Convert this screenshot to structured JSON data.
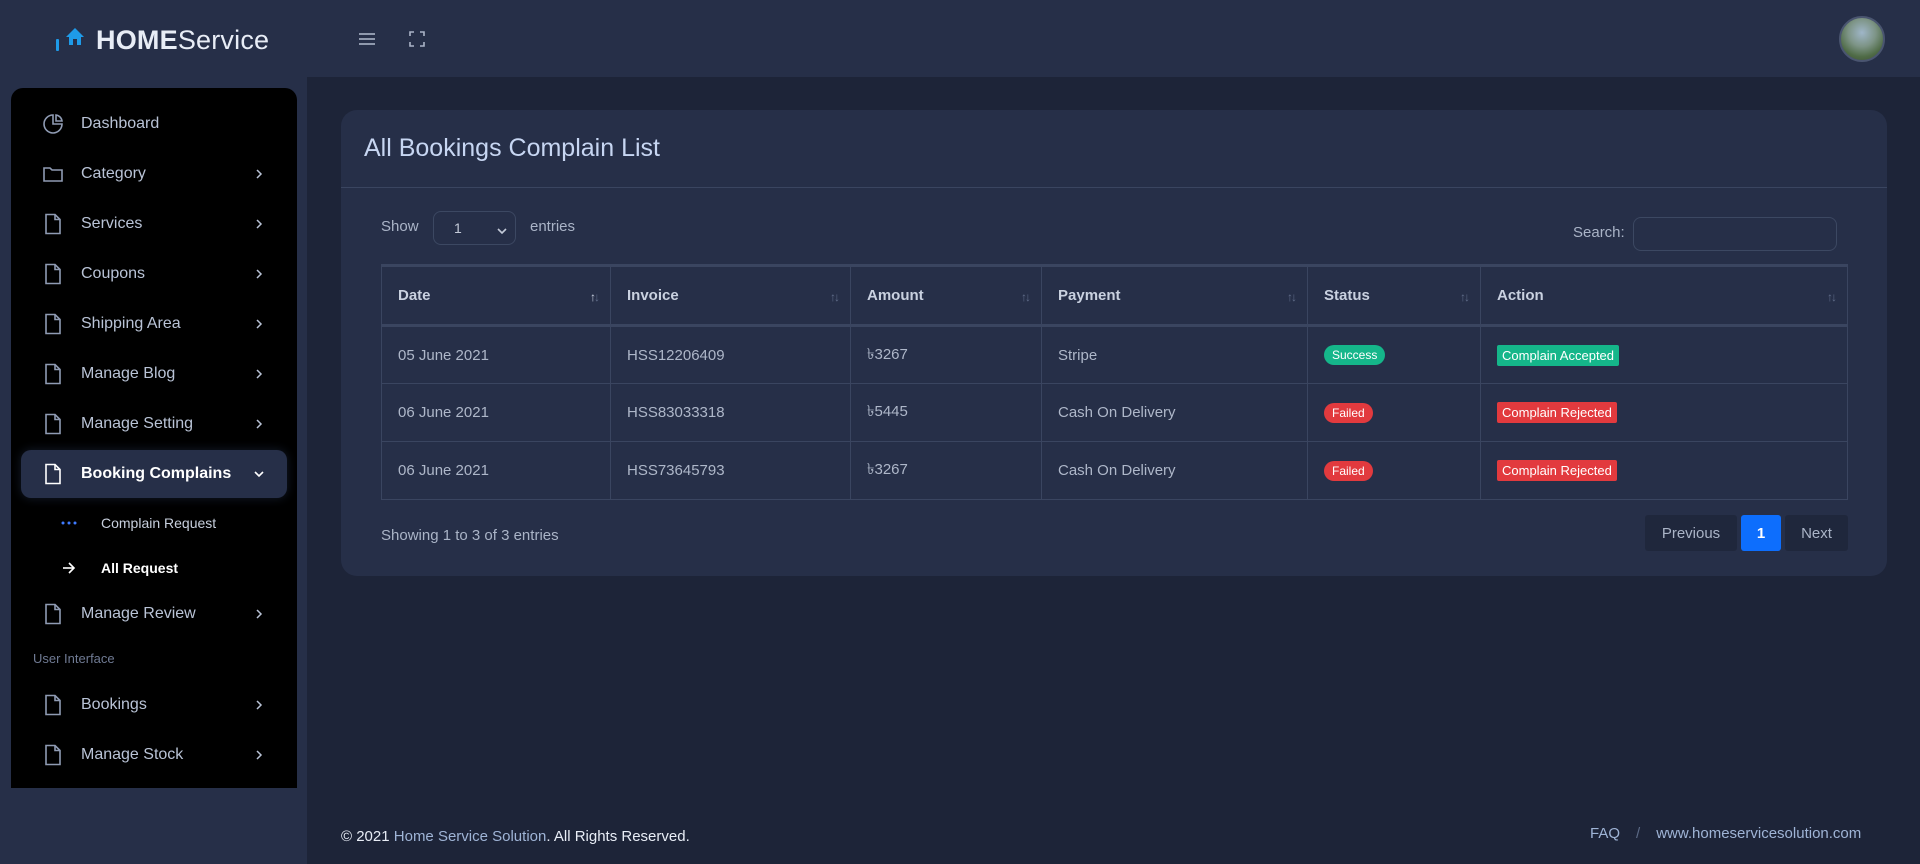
{
  "brand": {
    "bold": "HOME",
    "rest": "Service"
  },
  "sidebar": {
    "items": [
      {
        "label": "Dashboard",
        "icon": "pie-chart-icon",
        "chevron": false
      },
      {
        "label": "Category",
        "icon": "folder-icon",
        "chevron": true
      },
      {
        "label": "Services",
        "icon": "file-icon",
        "chevron": true
      },
      {
        "label": "Coupons",
        "icon": "file-icon",
        "chevron": true
      },
      {
        "label": "Shipping Area",
        "icon": "file-icon",
        "chevron": true
      },
      {
        "label": "Manage Blog",
        "icon": "file-icon",
        "chevron": true
      },
      {
        "label": "Manage Setting",
        "icon": "file-icon",
        "chevron": true
      },
      {
        "label": "Booking Complains",
        "icon": "file-icon",
        "chevron": true,
        "expanded": true
      },
      {
        "label": "Manage Review",
        "icon": "file-icon",
        "chevron": true
      },
      {
        "label": "Bookings",
        "icon": "file-icon",
        "chevron": true
      },
      {
        "label": "Manage Stock",
        "icon": "file-icon",
        "chevron": true
      }
    ],
    "sub_items": [
      {
        "label": "Complain Request",
        "icon": "dots-icon"
      },
      {
        "label": "All Request",
        "icon": "arrow-right-icon"
      }
    ],
    "section_label": "User Interface"
  },
  "page": {
    "title": "All Bookings Complain List",
    "show_label": "Show",
    "entries_label": "entries",
    "entries_value": "1",
    "search_label": "Search:",
    "search_placeholder": ""
  },
  "table": {
    "columns": [
      "Date",
      "Invoice",
      "Amount",
      "Payment",
      "Status",
      "Action"
    ],
    "rows": [
      {
        "date": "05 June 2021",
        "invoice": "HSS12206409",
        "amount": "৳3267",
        "payment": "Stripe",
        "status": "Success",
        "action": "Complain Accepted"
      },
      {
        "date": "06 June 2021",
        "invoice": "HSS83033318",
        "amount": "৳5445",
        "payment": "Cash On Delivery",
        "status": "Failed",
        "action": "Complain Rejected"
      },
      {
        "date": "06 June 2021",
        "invoice": "HSS73645793",
        "amount": "৳3267",
        "payment": "Cash On Delivery",
        "status": "Failed",
        "action": "Complain Rejected"
      }
    ]
  },
  "pagination": {
    "summary": "Showing 1 to 3 of 3 entries",
    "previous": "Previous",
    "current": "1",
    "next": "Next"
  },
  "footer": {
    "prefix": "© 2021",
    "company": "Home Service Solution",
    "suffix": ". All Rights Reserved.",
    "faq": "FAQ",
    "separator": "/",
    "website": "www.homeservicesolution.com"
  },
  "colors": {
    "accent_blue": "#0d6efd",
    "success": "#15b68a",
    "danger": "#e23a3e",
    "brand_icon": "#1e9be9"
  }
}
